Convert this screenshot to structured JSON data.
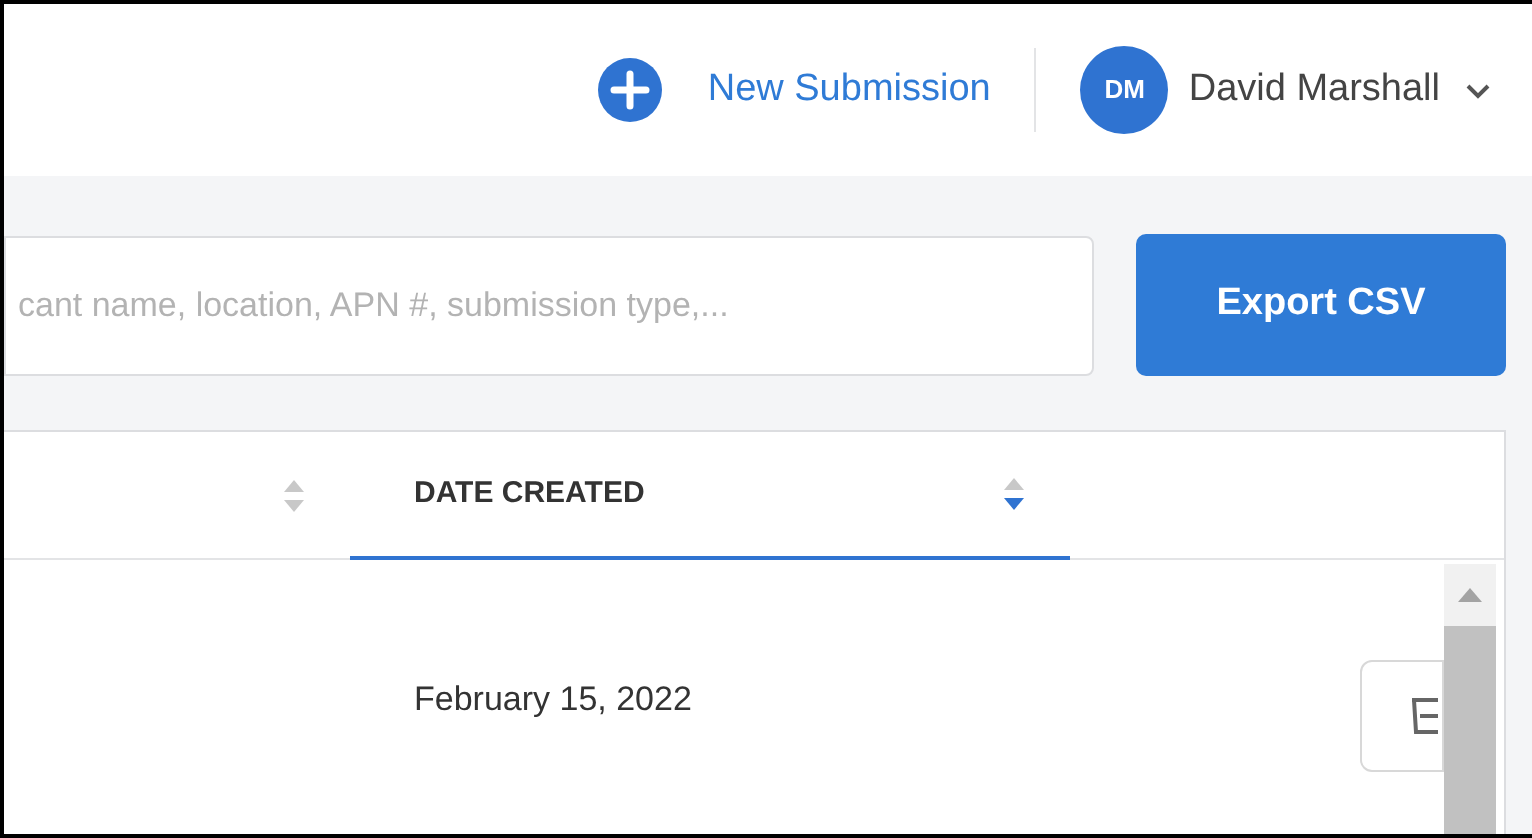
{
  "header": {
    "new_submission": {
      "label": "New Submission"
    },
    "user": {
      "initials": "DM",
      "name": "David Marshall"
    }
  },
  "search": {
    "placeholder": "cant name, location, APN #, submission type,..."
  },
  "export_button": {
    "label": "Export CSV"
  },
  "table": {
    "columns": [
      {
        "sorted_descending": false,
        "selected": false
      },
      {
        "label": "DATE CREATED",
        "sorted_descending": true,
        "selected": true
      }
    ],
    "rows": [
      {
        "date_created": "February 15, 2022"
      }
    ]
  }
}
